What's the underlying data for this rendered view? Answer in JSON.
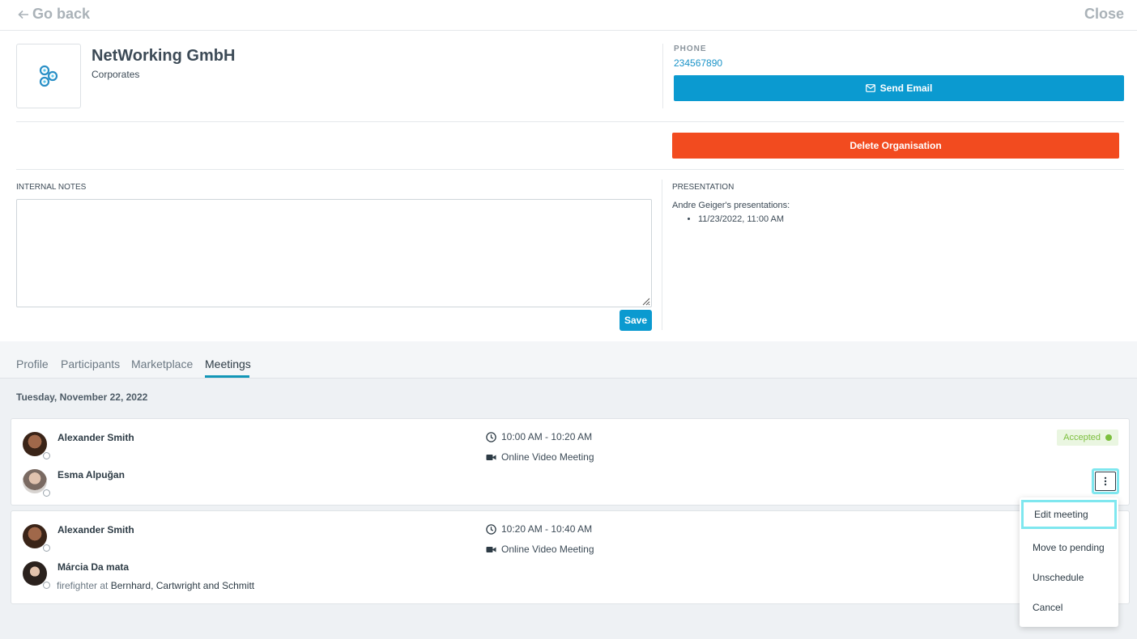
{
  "topbar": {
    "back_label": "Go back",
    "close_label": "Close"
  },
  "org": {
    "name": "NetWorking GmbH",
    "type": "Corporates",
    "phone_label": "PHONE",
    "phone": "234567890",
    "send_email_label": "Send Email",
    "delete_label": "Delete Organisation"
  },
  "notes": {
    "label": "INTERNAL NOTES",
    "value": "",
    "save_label": "Save"
  },
  "presentation": {
    "label": "PRESENTATION",
    "intro": "Andre Geiger's presentations:",
    "items": [
      "11/23/2022, 11:00 AM"
    ]
  },
  "tabs": [
    "Profile",
    "Participants",
    "Marketplace",
    "Meetings"
  ],
  "active_tab": "Meetings",
  "day_label": "Tuesday, November 22, 2022",
  "meetings": [
    {
      "host": "Alexander Smith",
      "guest": "Esma Alpuğan",
      "time": "10:00 AM - 10:20 AM",
      "type": "Online Video Meeting",
      "status": "Accepted"
    },
    {
      "host": "Alexander Smith",
      "guest": "Márcia Da mata",
      "guest_role": "firefighter at",
      "guest_company": "Bernhard, Cartwright and Schmitt",
      "time": "10:20 AM - 10:40 AM",
      "type": "Online Video Meeting"
    }
  ],
  "menu": [
    "Edit meeting",
    "Move to pending",
    "Unschedule",
    "Cancel"
  ],
  "colors": {
    "primary": "#0b9ad0",
    "danger": "#f24b1f",
    "accepted": "#7cbf3e",
    "focus": "#7fe7ef"
  }
}
